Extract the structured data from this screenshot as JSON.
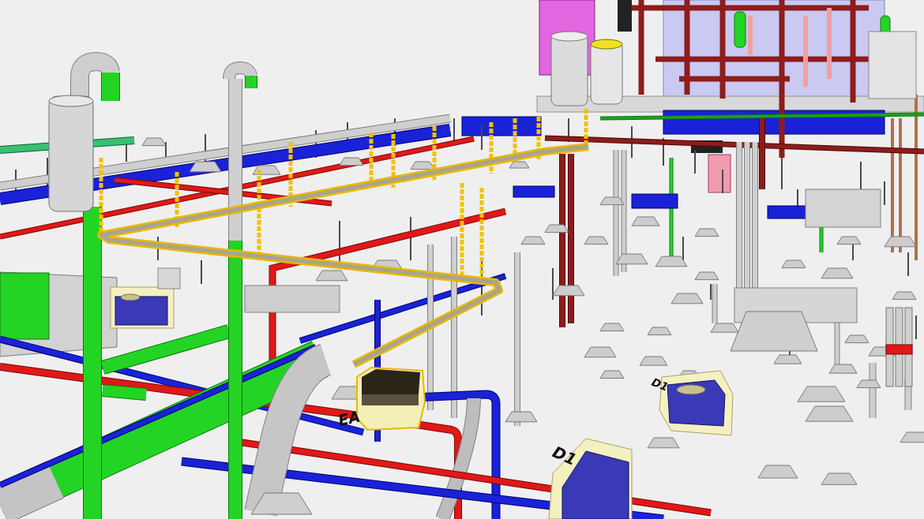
{
  "scene": {
    "equipment_tags": [
      {
        "text": "EA"
      },
      {
        "text": "D1"
      },
      {
        "text": "D1"
      }
    ]
  }
}
